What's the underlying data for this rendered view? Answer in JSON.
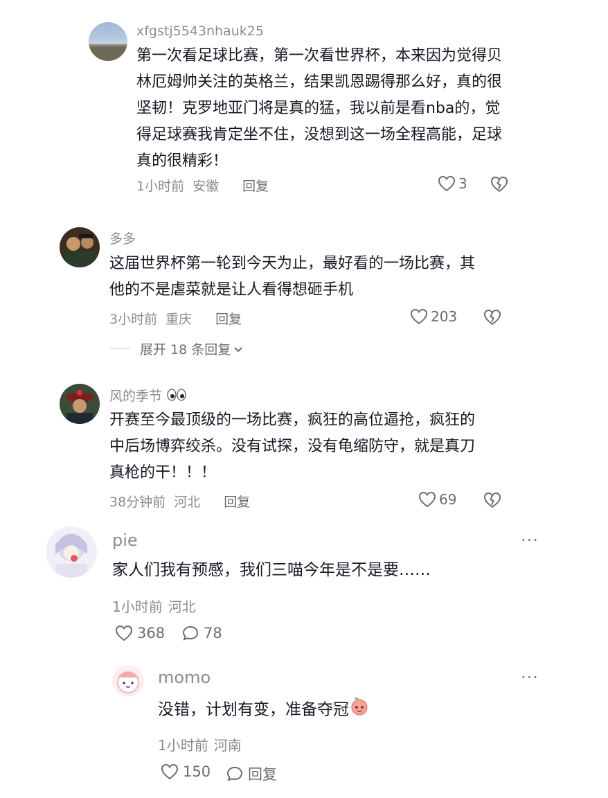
{
  "comments": [
    {
      "username": "xfgstj5543nhauk25",
      "lines": [
        "第一次看足球比赛，第一次看世界杯，本来因为觉得贝",
        "林厄姆帅关注的英格兰，结果凯恩踢得那么好，真的很",
        "坚韧！克罗地亚门将是真的猛，我以前是看nba的，觉",
        "得足球赛我肯定坐不住，没想到这一场全程高能，足球",
        "真的很精彩！"
      ],
      "time": "1小时前",
      "location": "安徽",
      "reply_label": "回复",
      "likes": "3"
    },
    {
      "username": "多多",
      "lines": [
        "这届世界杯第一轮到今天为止，最好看的一场比赛，其",
        "他的不是虐菜就是让人看得想砸手机"
      ],
      "time": "3小时前",
      "location": "重庆",
      "reply_label": "回复",
      "likes": "203",
      "expand_label": "展开 18 条回复"
    },
    {
      "username": "风的季节",
      "lines": [
        "开赛至今最顶级的一场比赛，疯狂的高位逼抢，疯狂的",
        "中后场博弈绞杀。没有试探，没有龟缩防守，就是真刀",
        "真枪的干！！！"
      ],
      "time": "38分钟前",
      "location": "河北",
      "reply_label": "回复",
      "likes": "69"
    },
    {
      "username": "pie",
      "text": "家人们我有预感，我们三喵今年是不是要……",
      "time": "1小时前",
      "location": "河北",
      "likes": "368",
      "replies": "78",
      "more": "···"
    },
    {
      "username": "momo",
      "text": "没错，计划有变，准备夺冠",
      "time": "1小时前",
      "location": "河南",
      "likes": "150",
      "reply_label": "回复",
      "more": "···"
    }
  ],
  "icons": {
    "heart": "heart-icon",
    "dislike": "broken-heart-icon",
    "chevron": "chevron-down-icon",
    "more": "more-icon",
    "comment_bubble": "comment-bubble-icon",
    "eyes_emoji": "eyes-emoji-icon",
    "peach_emoji": "peach-emoji-icon"
  },
  "colors": {
    "text": "#161823",
    "secondary": "#8a8b91",
    "background": "#ffffff"
  }
}
